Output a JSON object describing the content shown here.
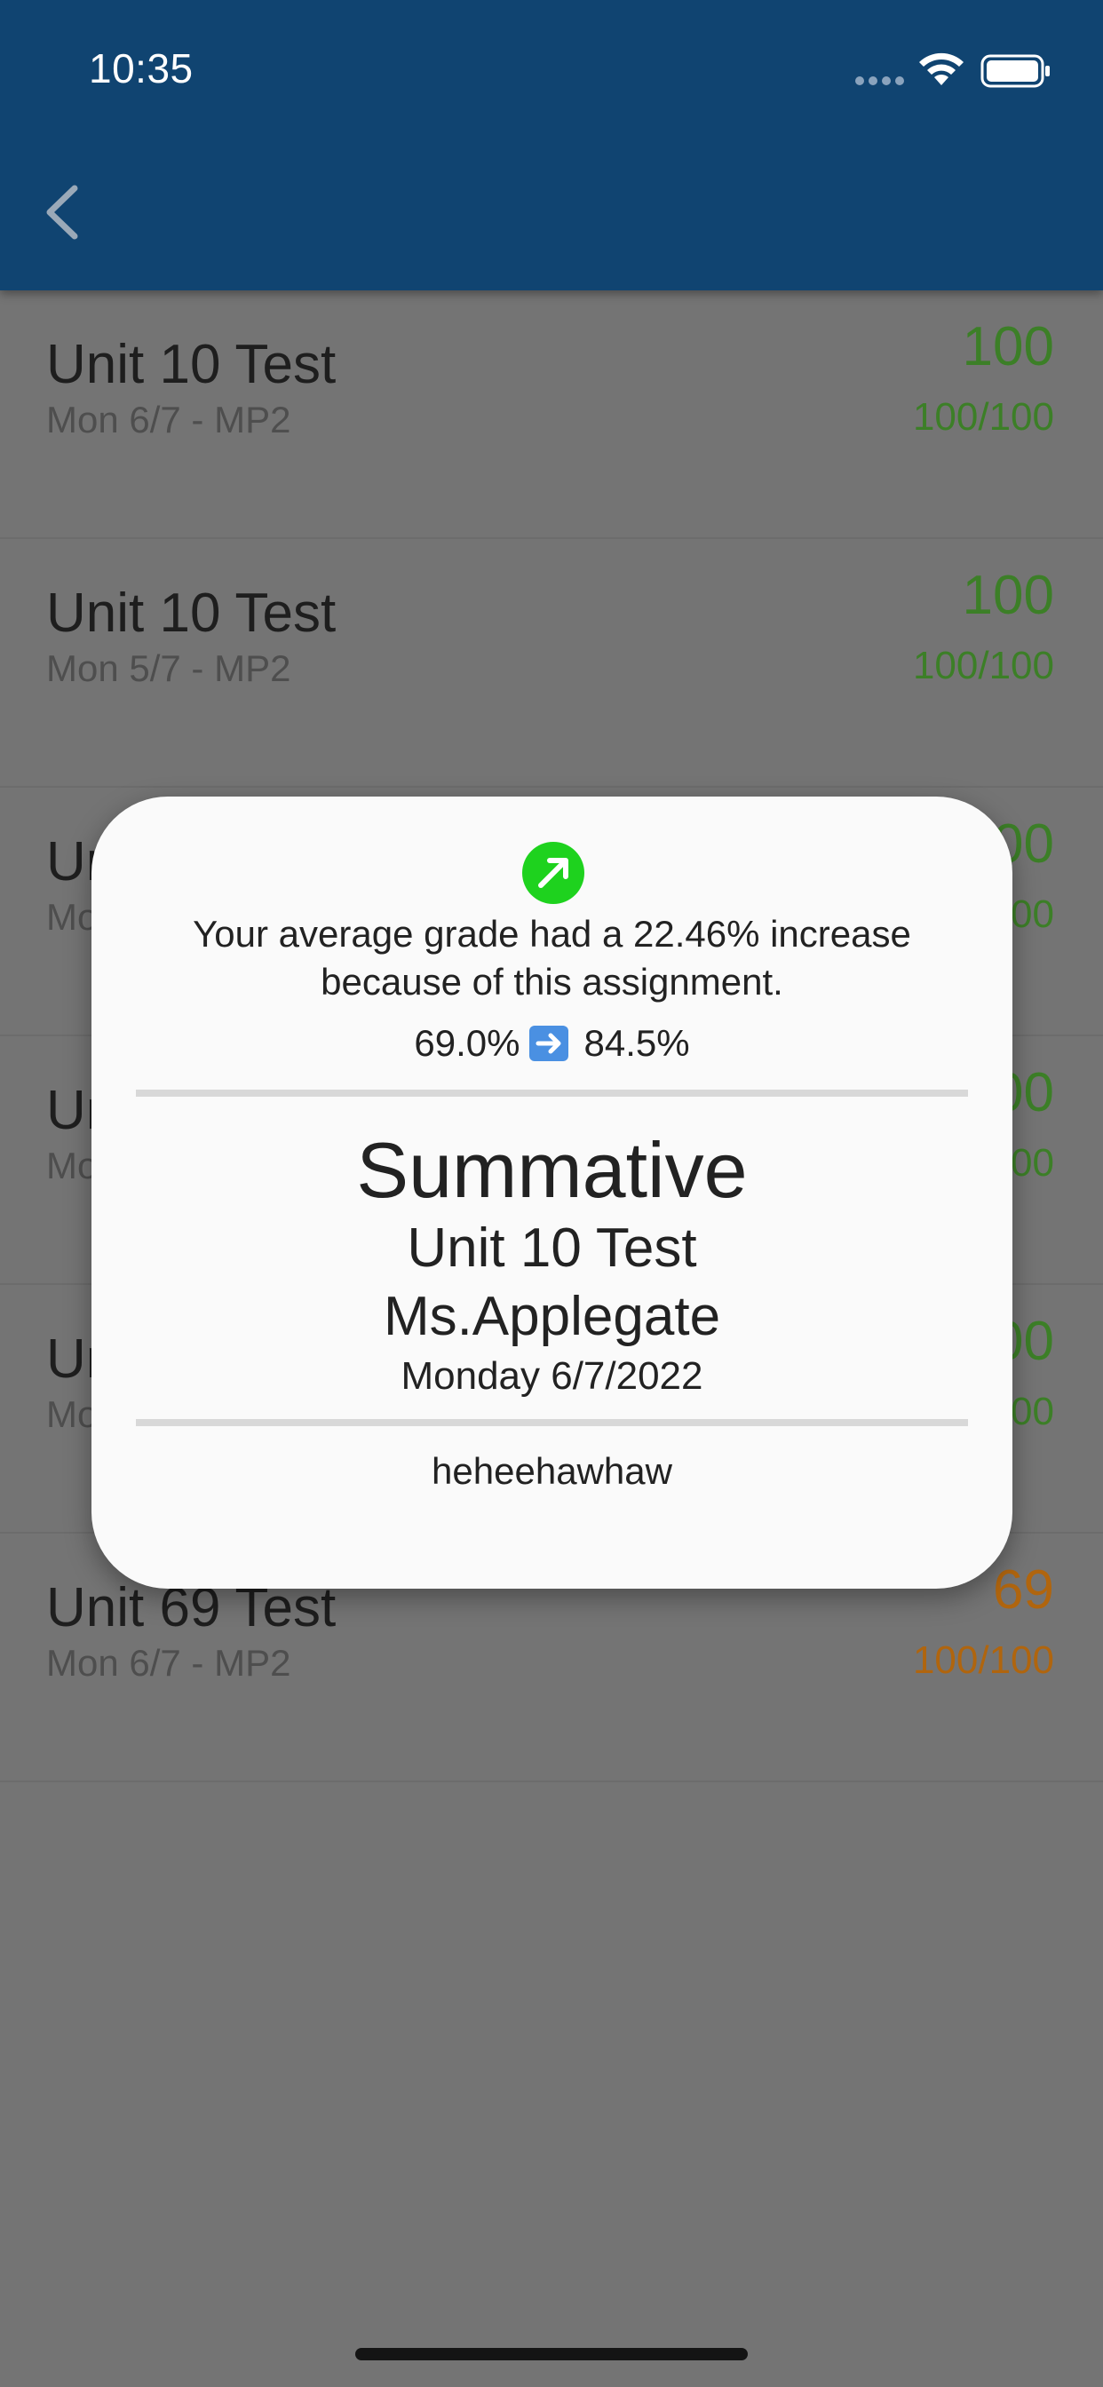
{
  "status_bar": {
    "time": "10:35"
  },
  "assignments": [
    {
      "title": "Unit 10 Test",
      "subtitle": "Mon 6/7 - MP2",
      "grade": "100",
      "score": "100/100",
      "color": "#3c7f27"
    },
    {
      "title": "Unit 10 Test",
      "subtitle": "Mon 5/7 - MP2",
      "grade": "100",
      "score": "100/100",
      "color": "#3c7f27"
    },
    {
      "title": "Unit 10 Test",
      "subtitle": "Mon 6/7 - MP2",
      "grade": "100",
      "score": "100/100",
      "color": "#3c7f27"
    },
    {
      "title": "Unit 10 Test",
      "subtitle": "Mon 6/7 - MP2",
      "grade": "100",
      "score": "100/100",
      "color": "#3c7f27"
    },
    {
      "title": "Unit 10 Test",
      "subtitle": "Mon 6/7 - MP2",
      "grade": "100",
      "score": "100/100",
      "color": "#3c7f27"
    },
    {
      "title": "Unit 69 Test",
      "subtitle": "Mon 6/7 - MP2",
      "grade": "69",
      "score": "100/100",
      "color": "#b0650e"
    }
  ],
  "modal": {
    "change_message": "Your average grade had a 22.46% increase because of this assignment.",
    "grade_before": "69.0%",
    "grade_after": "84.5%",
    "category": "Summative",
    "assignment": "Unit 10 Test",
    "teacher": "Ms.Applegate",
    "date": "Monday 6/7/2022",
    "comment": "heheehawhaw"
  },
  "colors": {
    "header": "#104471",
    "increase_icon": "#1ed21e",
    "passing_grade": "#3c7f27",
    "low_grade": "#b0650e"
  },
  "icons": [
    "back-icon",
    "wifi-icon",
    "battery-icon",
    "trend-up-icon",
    "arrow-right-icon"
  ]
}
